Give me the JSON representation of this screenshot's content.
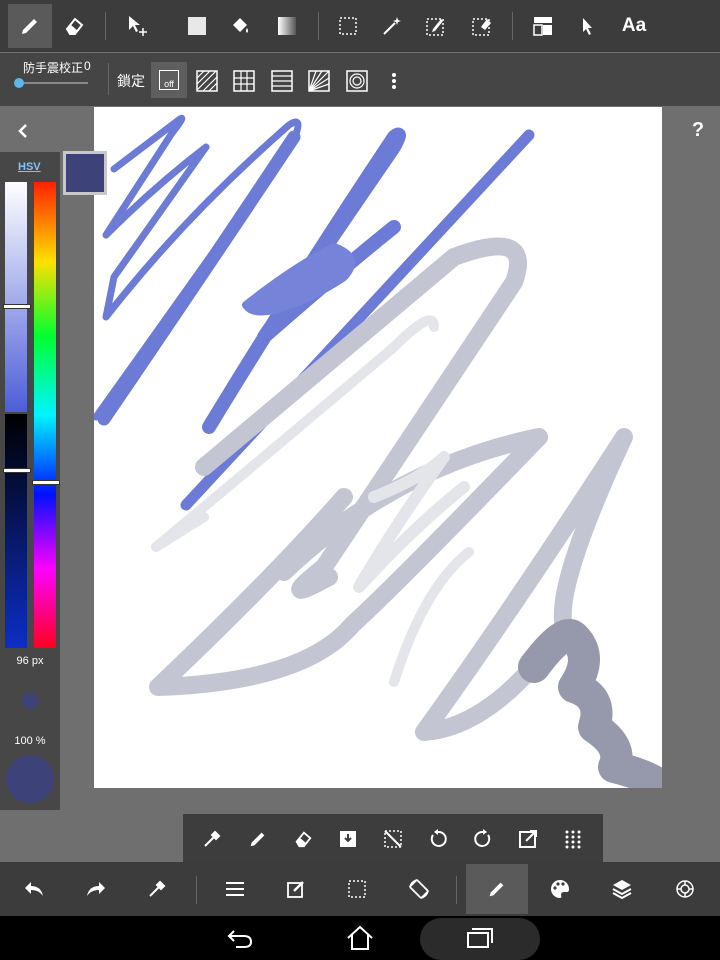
{
  "toolbar": {
    "items": [
      "pen-icon",
      "eraser-icon",
      "move-icon",
      "fill-rect-icon",
      "bucket-icon",
      "gradient-icon",
      "select-rect-icon",
      "magic-wand-icon",
      "select-pen-icon",
      "select-eraser-icon",
      "layer-panel-icon",
      "operation-icon",
      "text-icon"
    ],
    "text_tool_label": "Aa"
  },
  "stabilizer": {
    "label": "防手震校正",
    "value": "0"
  },
  "snap": {
    "label": "鎖定",
    "off_label": "off"
  },
  "help_label": "?",
  "color_panel": {
    "mode_label": "HSV",
    "current_color": "#3d4378",
    "brush_size": "96 px",
    "opacity": "100 %",
    "sv_level": 0.53,
    "hue_level": 0.64,
    "value_level": 0.23
  },
  "bottom_tools": [
    "eyedropper-icon",
    "pen-icon",
    "eraser-icon",
    "save-icon",
    "clear-selection-icon",
    "rotate-left-icon",
    "rotate-right-icon",
    "external-icon",
    "grid-icon"
  ],
  "bottom_bar": [
    "undo-icon",
    "redo-icon",
    "eyedropper-icon",
    "menu-icon",
    "edit-icon",
    "selection-icon",
    "rotate-screen-icon",
    "pen-icon",
    "palette-icon",
    "layers-icon",
    "settings-icon"
  ],
  "colors": {
    "stroke_blue": "#6b7bd6",
    "stroke_gray": "#c3c6d2",
    "stroke_light": "#e4e5ea",
    "stroke_dark": "#9599ab"
  }
}
